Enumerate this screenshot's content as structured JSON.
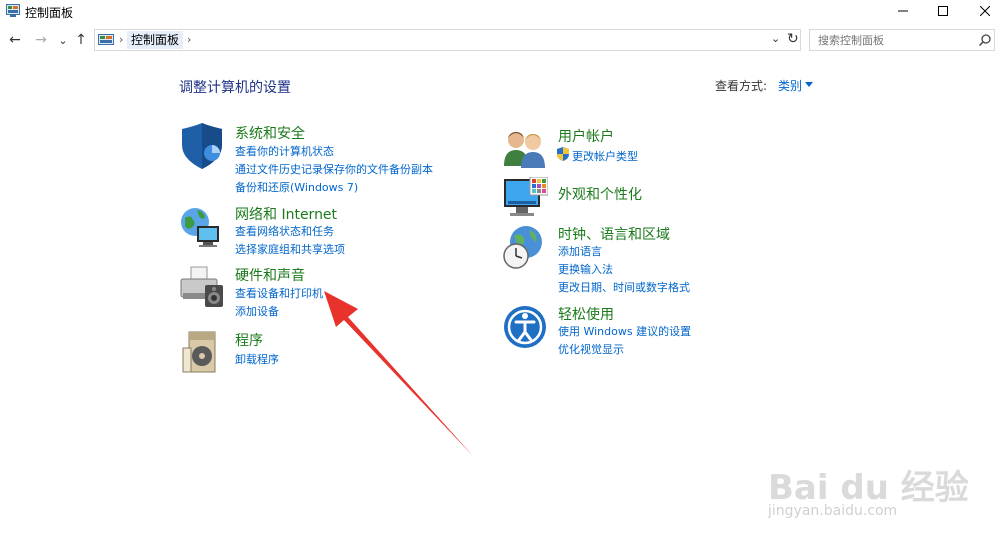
{
  "window": {
    "title": "控制面板"
  },
  "nav": {
    "back": "←",
    "forward": "→",
    "recent": "⌄",
    "up": "↑"
  },
  "address": {
    "crumb": "控制面板",
    "search_placeholder": "搜索控制面板"
  },
  "main": {
    "title": "调整计算机的设置",
    "view_by_label": "查看方式:",
    "view_by_value": "类别"
  },
  "categories_left": [
    {
      "title": "系统和安全",
      "links": [
        "查看你的计算机状态",
        "通过文件历史记录保存你的文件备份副本",
        "备份和还原(Windows 7)"
      ]
    },
    {
      "title": "网络和 Internet",
      "links": [
        "查看网络状态和任务",
        "选择家庭组和共享选项"
      ]
    },
    {
      "title": "硬件和声音",
      "links": [
        "查看设备和打印机",
        "添加设备"
      ]
    },
    {
      "title": "程序",
      "links": [
        "卸载程序"
      ]
    }
  ],
  "categories_right": [
    {
      "title": "用户帐户",
      "links": [
        "更改帐户类型"
      ]
    },
    {
      "title": "外观和个性化",
      "links": []
    },
    {
      "title": "时钟、语言和区域",
      "links": [
        "添加语言",
        "更换输入法",
        "更改日期、时间或数字格式"
      ]
    },
    {
      "title": "轻松使用",
      "links": [
        "使用 Windows 建议的设置",
        "优化视觉显示"
      ]
    }
  ],
  "colors": {
    "title_blue": "#1e3287",
    "category_green": "#1a7a1a",
    "link_blue": "#0066cc",
    "annotation_red": "#e8322c"
  },
  "watermark": {
    "brand": "Bai du 经验",
    "url": "jingyan.baidu.com"
  }
}
